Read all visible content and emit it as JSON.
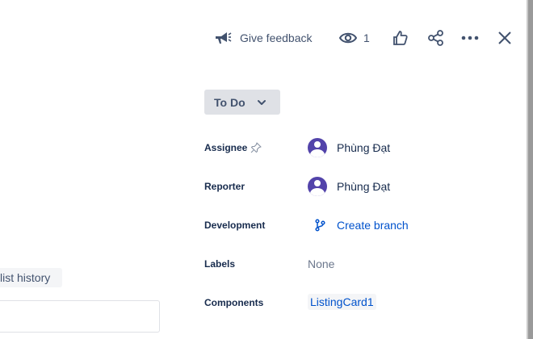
{
  "toolbar": {
    "feedback_label": "Give feedback",
    "watchers_count": "1"
  },
  "status": {
    "label": "To Do"
  },
  "left": {
    "history_tag": "list history"
  },
  "fields": {
    "assignee": {
      "label": "Assignee",
      "value": "Phùng Đạt"
    },
    "reporter": {
      "label": "Reporter",
      "value": "Phùng Đạt"
    },
    "development": {
      "label": "Development",
      "value": "Create branch"
    },
    "labels": {
      "label": "Labels",
      "value": "None"
    },
    "components": {
      "label": "Components",
      "value": "ListingCard1"
    }
  },
  "icons": {
    "feedback": "megaphone-icon",
    "watch": "eye-icon",
    "like": "thumbs-up-icon",
    "share": "share-icon",
    "more": "more-icon",
    "close": "close-icon",
    "status_chevron": "chevron-down-icon",
    "pin": "pin-icon",
    "branch": "branch-icon"
  },
  "colors": {
    "link": "#0052cc",
    "avatar": "#5243aa",
    "status_bg": "#dfe1e6"
  }
}
